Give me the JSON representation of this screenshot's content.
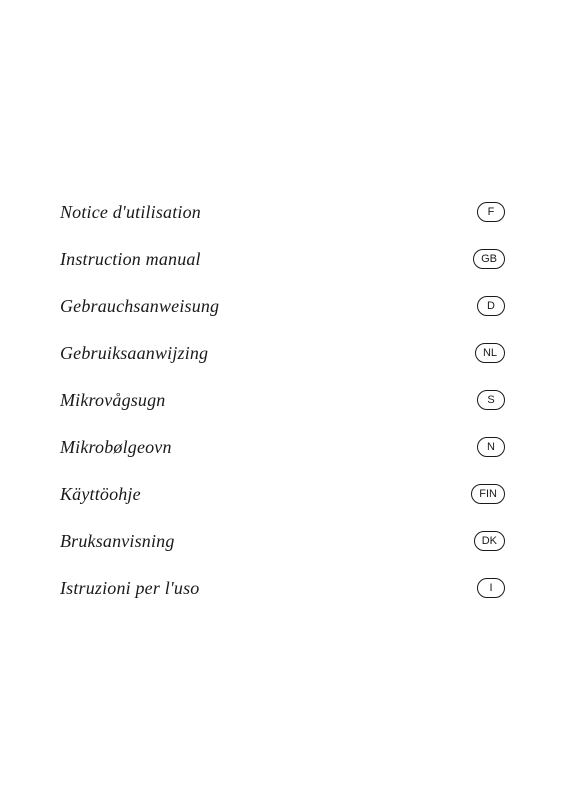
{
  "manuals": [
    {
      "label": "Notice d'utilisation",
      "badge": "F"
    },
    {
      "label": "Instruction manual",
      "badge": "GB"
    },
    {
      "label": "Gebrauchsanweisung",
      "badge": "D"
    },
    {
      "label": "Gebruiksaanwijzing",
      "badge": "NL"
    },
    {
      "label": "Mikrovågsugn",
      "badge": "S"
    },
    {
      "label": "Mikrobølgeovn",
      "badge": "N"
    },
    {
      "label": "Käyttöohje",
      "badge": "FIN"
    },
    {
      "label": "Bruksanvisning",
      "badge": "DK"
    },
    {
      "label": "Istruzioni per l'uso",
      "badge": "I"
    }
  ]
}
